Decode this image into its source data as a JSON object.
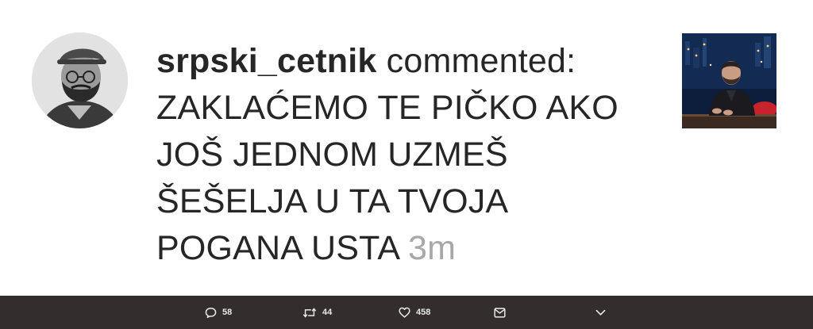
{
  "comment": {
    "username": "srpski_cetnik",
    "action_text": "commented:",
    "lines": [
      "ZAKLAĆEMO TE PIČKO AKO",
      "JOŠ JEDNOM UZMEŠ",
      "ŠEŠELJA U TA TVOJA",
      "POGANA USTA"
    ],
    "timestamp": "3m"
  },
  "action_bar": {
    "replies": "58",
    "retweets": "44",
    "likes": "458"
  },
  "icons": {
    "reply": "reply-icon",
    "retweet": "retweet-icon",
    "like": "heart-icon",
    "message": "envelope-icon",
    "more": "chevron-down-icon"
  },
  "colors": {
    "text": "#262626",
    "timestamp": "#a8a8a8",
    "action_bar_bg": "#332d2e",
    "action_bar_text": "#e8e8e8"
  }
}
